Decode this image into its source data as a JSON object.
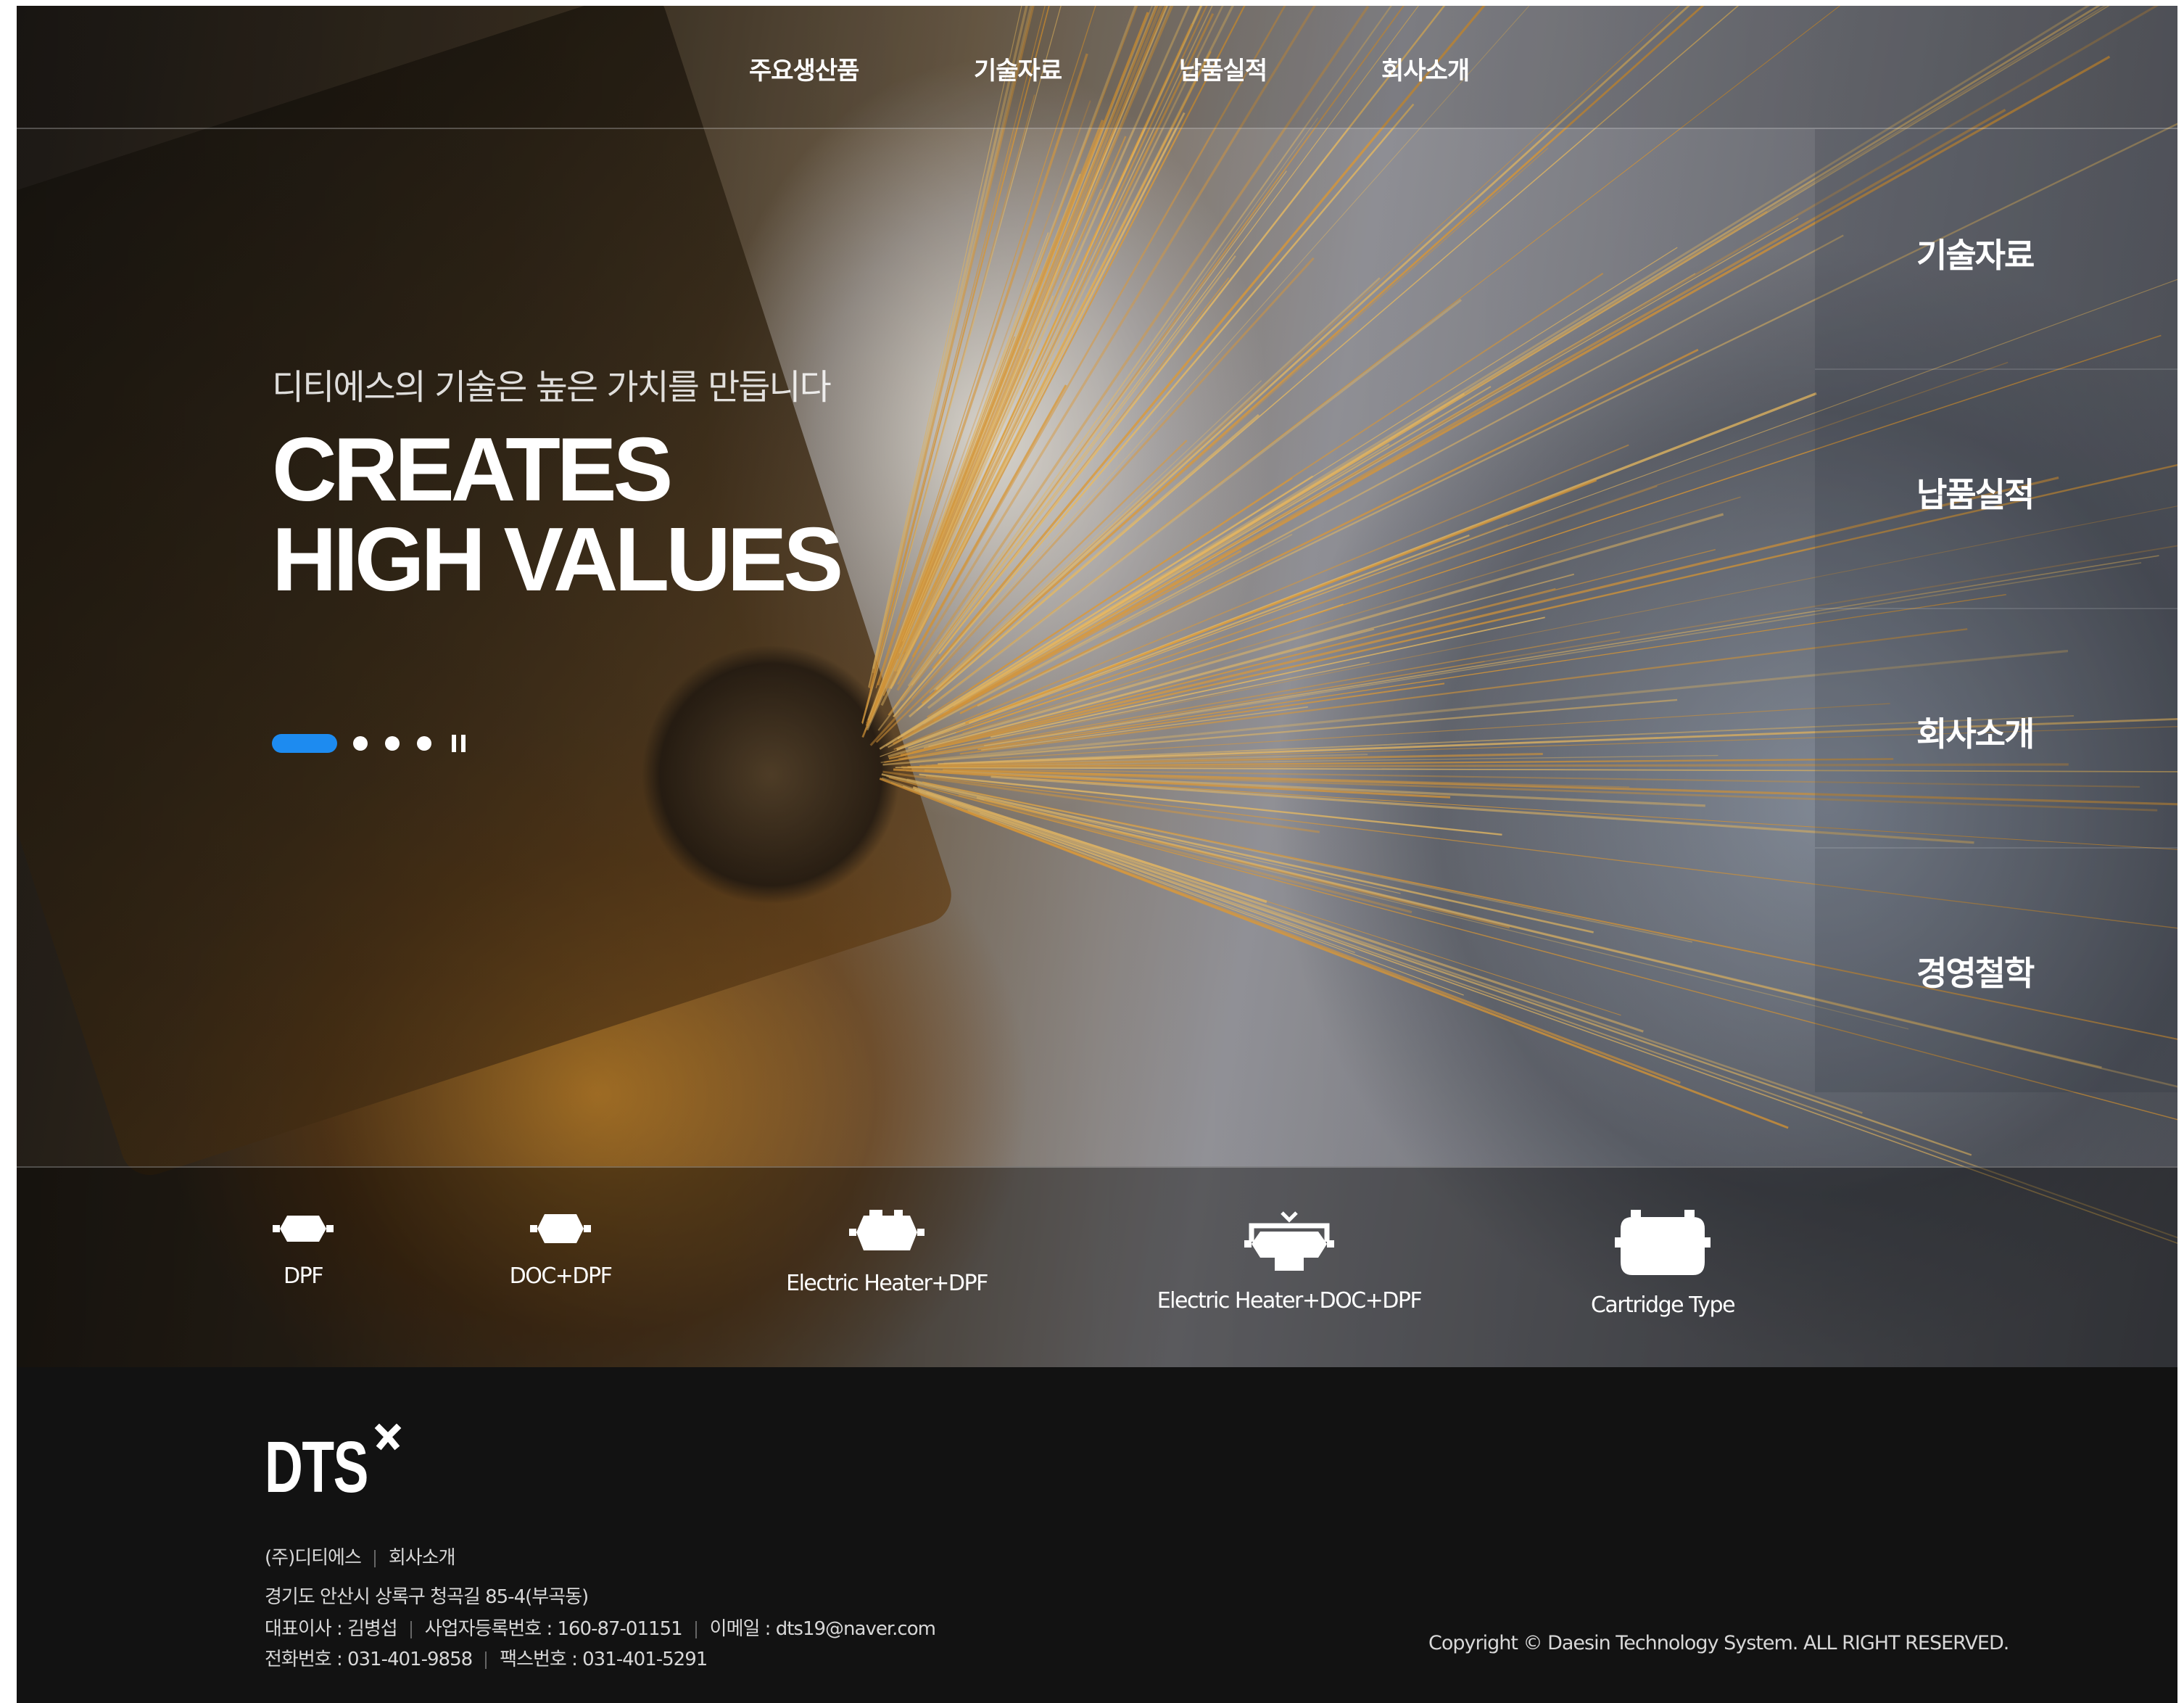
{
  "topnav": {
    "items": [
      {
        "label": "주요생산품"
      },
      {
        "label": "기술자료"
      },
      {
        "label": "납품실적"
      },
      {
        "label": "회사소개"
      }
    ]
  },
  "hero": {
    "subtitle": "디티에스의 기술은 높은 가치를 만듭니다",
    "title_line1": "CREATES",
    "title_line2": "HIGH VALUES",
    "slider": {
      "total_slides": 4,
      "active_index": 0,
      "accent_color": "#1d8bf0"
    }
  },
  "sidepanel": {
    "items": [
      {
        "label": "기술자료"
      },
      {
        "label": "납품실적"
      },
      {
        "label": "회사소개"
      },
      {
        "label": "경영철학"
      }
    ]
  },
  "products": [
    {
      "label": "DPF",
      "icon": "dpf-icon"
    },
    {
      "label": "DOC+DPF",
      "icon": "doc-dpf-icon"
    },
    {
      "label": "Electric Heater+DPF",
      "icon": "heater-dpf-icon"
    },
    {
      "label": "Electric Heater+DOC+DPF",
      "icon": "heater-doc-dpf-icon"
    },
    {
      "label": "Cartridge Type",
      "icon": "cartridge-icon"
    }
  ],
  "footer": {
    "logo_text": "DTS",
    "company": "(주)디티에스",
    "company_link": "회사소개",
    "address": "경기도 안산시 상록구 청곡길 85-4(부곡동)",
    "ceo": "대표이사 : 김병섭",
    "biz_no": "사업자등록번호 : 160-87-01151",
    "email": "이메일 : dts19@naver.com",
    "tel": "전화번호 : 031-401-9858",
    "fax": "팩스번호 : 031-401-5291",
    "copyright": "Copyright © Daesin Technology System. ALL RIGHT RESERVED."
  }
}
